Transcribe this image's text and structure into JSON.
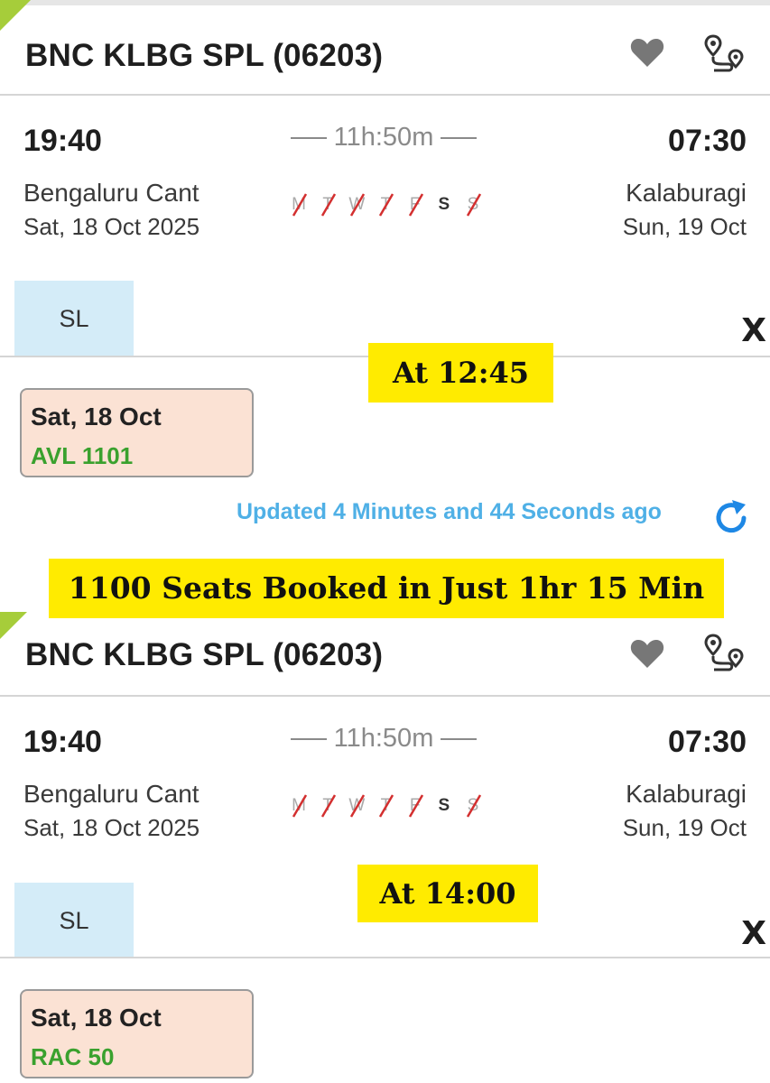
{
  "cards": [
    {
      "train_title": "BNC KLBG SPL (06203)",
      "depart_time": "19:40",
      "arrive_time": "07:30",
      "duration": "11h:50m",
      "from_station": "Bengaluru Cant",
      "from_date": "Sat, 18 Oct  2025",
      "to_station": "Kalaburagi",
      "to_date": "Sun, 19 Oct",
      "run_days": [
        {
          "label": "M",
          "runs": false
        },
        {
          "label": "T",
          "runs": false
        },
        {
          "label": "W",
          "runs": false
        },
        {
          "label": "T",
          "runs": false
        },
        {
          "label": "F",
          "runs": false
        },
        {
          "label": "S",
          "runs": true
        },
        {
          "label": "S",
          "runs": false
        }
      ],
      "class_tab": "SL",
      "close_label": "X",
      "availability": {
        "date": "Sat, 18 Oct",
        "status": "AVL 1101"
      },
      "updated_text": "Updated 4 Minutes and 44 Seconds ago"
    },
    {
      "train_title": "BNC KLBG SPL (06203)",
      "depart_time": "19:40",
      "arrive_time": "07:30",
      "duration": "11h:50m",
      "from_station": "Bengaluru Cant",
      "from_date": "Sat, 18 Oct  2025",
      "to_station": "Kalaburagi",
      "to_date": "Sun, 19 Oct",
      "run_days": [
        {
          "label": "M",
          "runs": false
        },
        {
          "label": "T",
          "runs": false
        },
        {
          "label": "W",
          "runs": false
        },
        {
          "label": "T",
          "runs": false
        },
        {
          "label": "F",
          "runs": false
        },
        {
          "label": "S",
          "runs": true
        },
        {
          "label": "S",
          "runs": false
        }
      ],
      "class_tab": "SL",
      "close_label": "X",
      "availability": {
        "date": "Sat, 18 Oct",
        "status": "RAC  50"
      }
    }
  ],
  "highlights": {
    "time_1": "At 12:45",
    "headline": "1100 Seats Booked in Just 1hr 15 Min",
    "time_2": "At 14:00"
  },
  "colors": {
    "accent_green": "#a6cd3a",
    "available_green": "#3aa12e",
    "updated_blue": "#4fb0e6",
    "highlight_yellow": "#ffeb00",
    "class_tab_blue": "#d4ecf8",
    "avl_box_peach": "#fbe2d4"
  },
  "icons": [
    "heart-icon",
    "route-map-icon",
    "refresh-icon",
    "close-icon"
  ]
}
